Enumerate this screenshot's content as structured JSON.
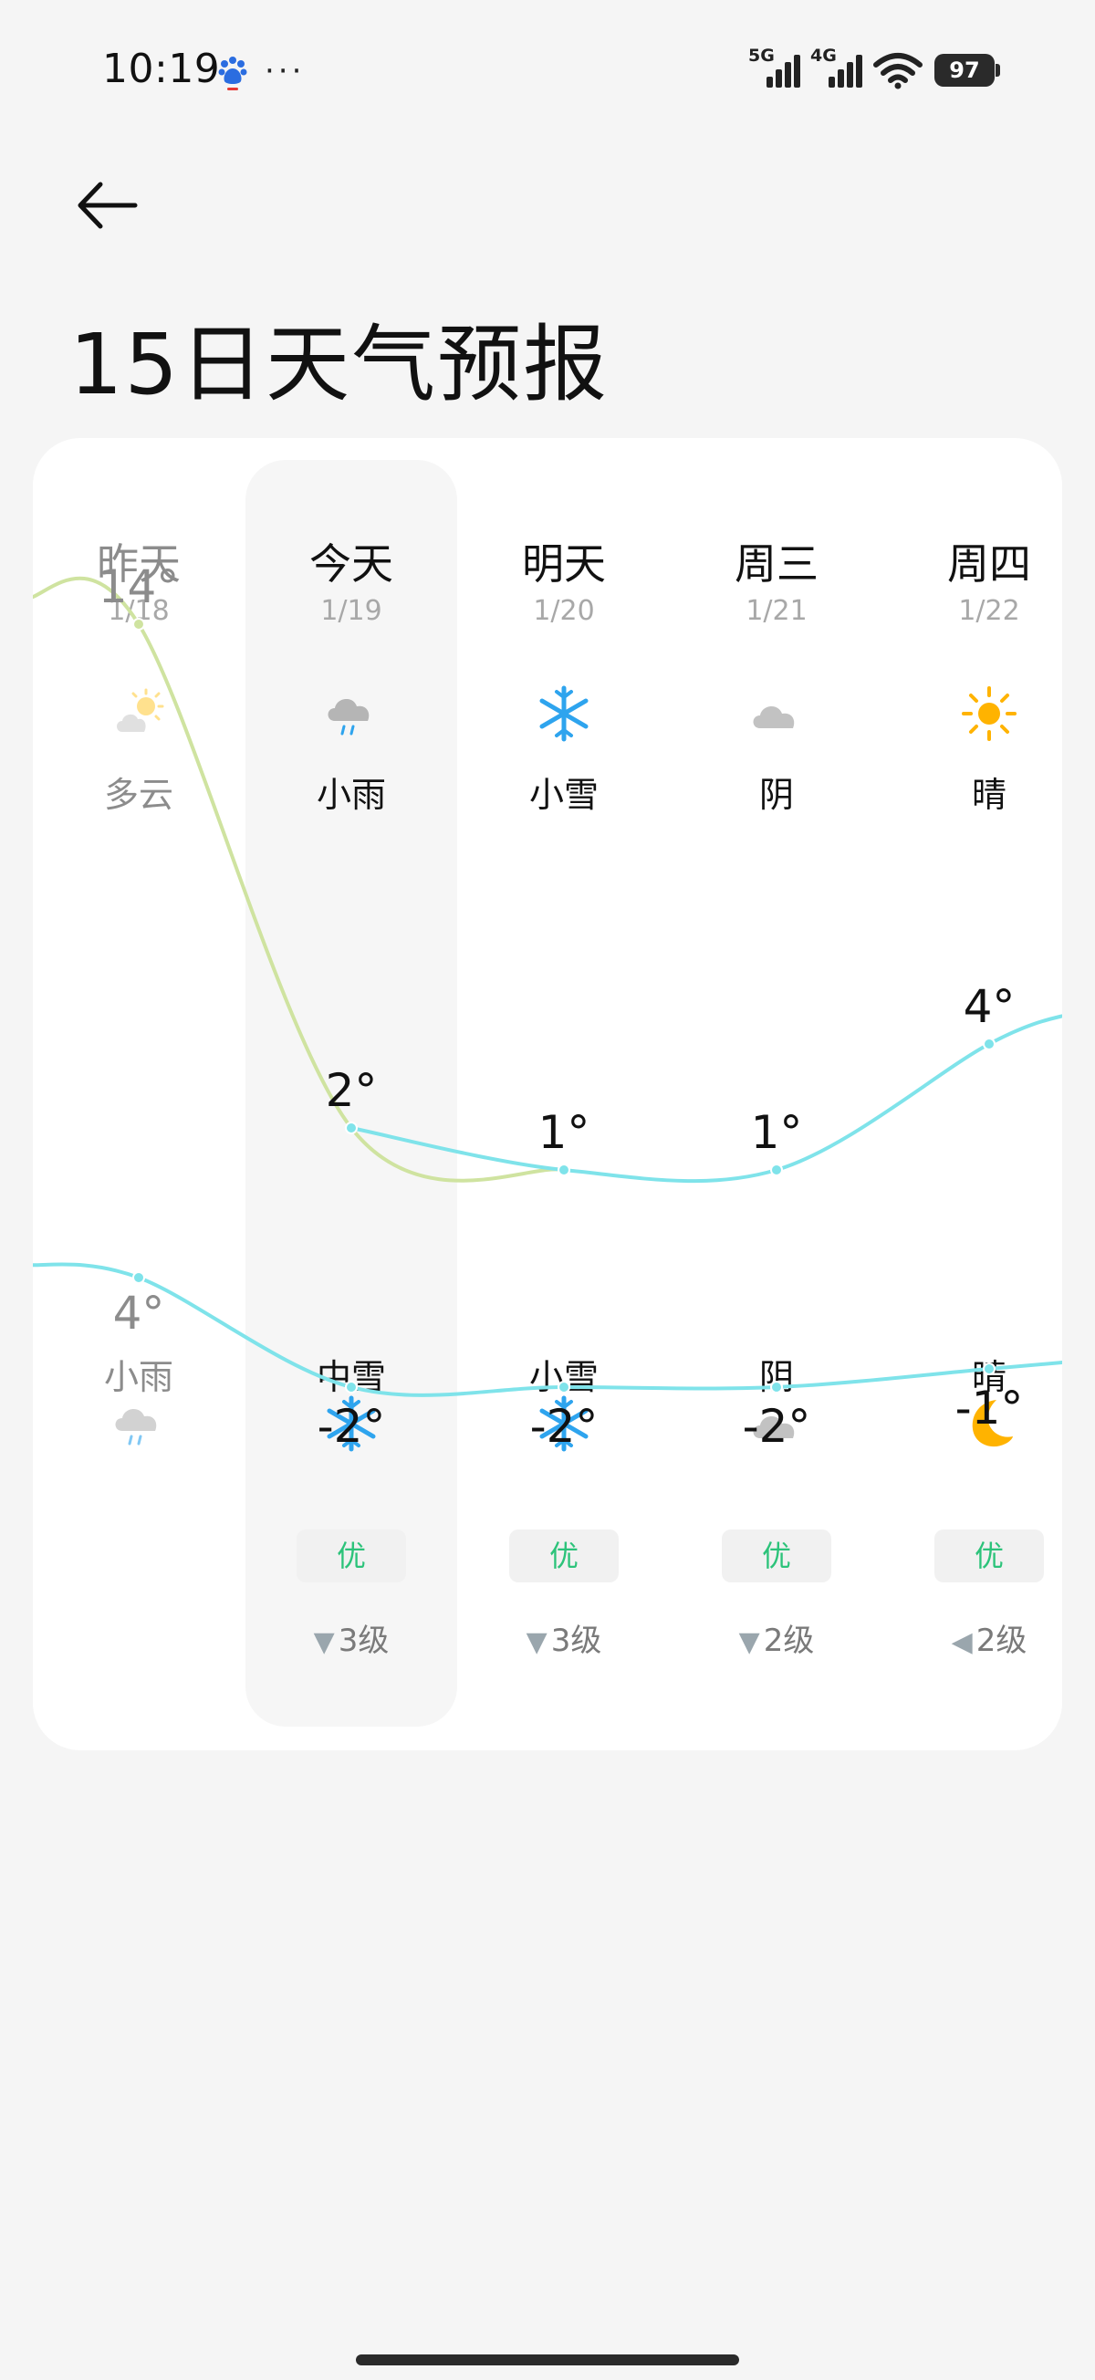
{
  "status": {
    "time": "10:19",
    "net1": "5G",
    "net2": "4G",
    "battery": "97",
    "more": "···"
  },
  "page": {
    "title": "15日天气预报"
  },
  "days": [
    {
      "day": "昨天",
      "date": "1/18",
      "day_cond": "多云",
      "night_cond": "小雨",
      "day_icon": "partly-cloudy-icon",
      "night_icon": "light-rain-icon",
      "aqi": "",
      "wind": "",
      "high": "14°",
      "low": "4°"
    },
    {
      "day": "今天",
      "date": "1/19",
      "day_cond": "小雨",
      "night_cond": "中雪",
      "day_icon": "light-rain-icon",
      "night_icon": "snow-icon",
      "aqi": "优",
      "wind": "3级",
      "high": "2°",
      "low": "-2°"
    },
    {
      "day": "明天",
      "date": "1/20",
      "day_cond": "小雪",
      "night_cond": "小雪",
      "day_icon": "snow-icon",
      "night_icon": "snow-icon",
      "aqi": "优",
      "wind": "3级",
      "high": "1°",
      "low": "-2°"
    },
    {
      "day": "周三",
      "date": "1/21",
      "day_cond": "阴",
      "night_cond": "阴",
      "day_icon": "cloud-icon",
      "night_icon": "cloud-icon",
      "aqi": "优",
      "wind": "2级",
      "high": "1°",
      "low": "-2°"
    },
    {
      "day": "周四",
      "date": "1/22",
      "day_cond": "晴",
      "night_cond": "晴",
      "day_icon": "sun-icon",
      "night_icon": "moon-icon",
      "aqi": "优",
      "wind": "2级",
      "high": "4°",
      "low": "-1°"
    }
  ],
  "chart_data": {
    "type": "line",
    "categories": [
      "1/18",
      "1/19",
      "1/20",
      "1/21",
      "1/22"
    ],
    "series": [
      {
        "values": [
          14,
          2,
          1,
          1,
          4
        ]
      },
      {
        "values": [
          4,
          -2,
          -2,
          -2,
          -1
        ]
      }
    ]
  },
  "colors": {
    "high_line_past": "#cfe3a0",
    "line": "#7fe3ea",
    "aqi_good": "#2cc37a",
    "snow": "#2ea4ee",
    "sun": "#ffb300"
  }
}
